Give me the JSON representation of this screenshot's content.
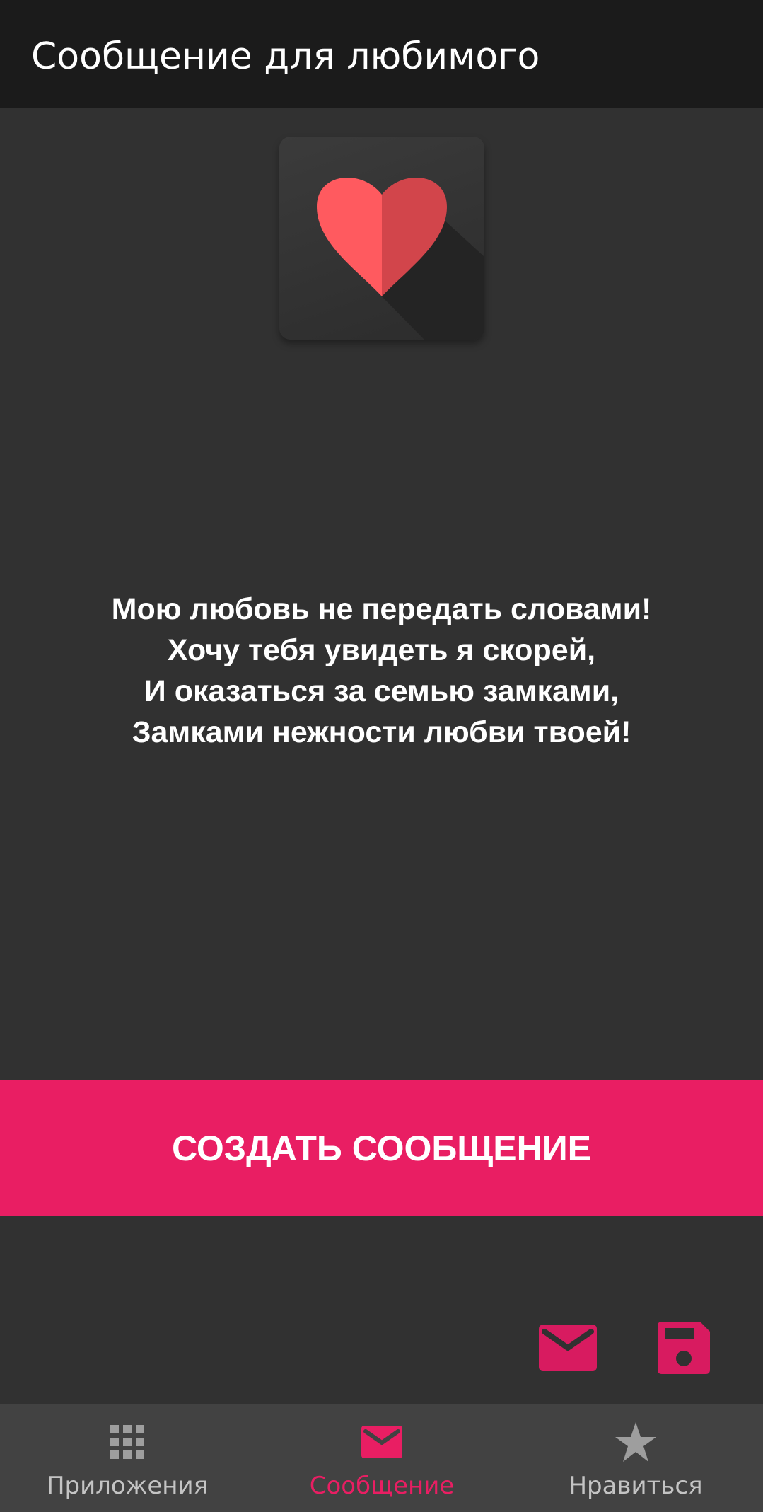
{
  "appbar": {
    "title": "Сообщение для любимого"
  },
  "poem": {
    "lines": [
      "Мою любовь не передать словами!",
      "Хочу тебя увидеть я скорей,",
      "И оказаться за семью замками,",
      "Замками нежности любви твоей!"
    ]
  },
  "actions": {
    "create_label": "СОЗДАТЬ СООБЩЕНИЕ",
    "send_icon": "mail-icon",
    "save_icon": "save-icon"
  },
  "bottom_nav": {
    "active_index": 1,
    "items": [
      {
        "label": "Приложения",
        "icon": "apps-grid-icon"
      },
      {
        "label": "Сообщение",
        "icon": "mail-icon"
      },
      {
        "label": "Нравиться",
        "icon": "star-icon"
      }
    ]
  },
  "colors": {
    "accent": "#e91e63",
    "accent_dark": "#d81b60",
    "appbar": "#1b1b1b",
    "background": "#313131",
    "nav_background": "#424242",
    "nav_inactive": "#c4c4c4",
    "heart_left": "#ff5a5f",
    "heart_right": "#d2454b"
  }
}
